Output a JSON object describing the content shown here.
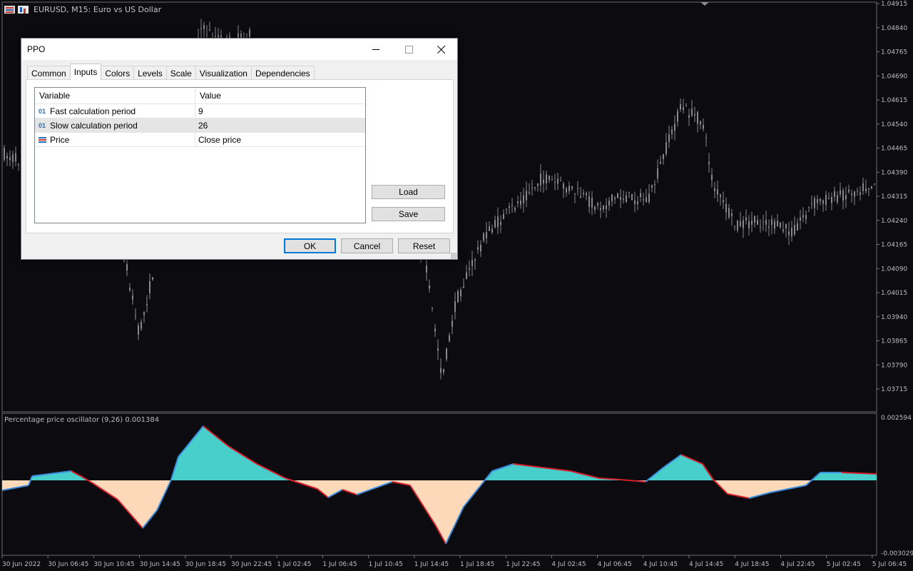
{
  "chart": {
    "title": "EURUSD, M15:  Euro vs US Dollar",
    "indicator_label": "Percentage price oscillator (9,26) 0.001384",
    "price_levels": [
      "1.04915",
      "1.04840",
      "1.04765",
      "1.04690",
      "1.04615",
      "1.04540",
      "1.04465",
      "1.04390",
      "1.04315",
      "1.04240",
      "1.04165",
      "1.04090",
      "1.04015",
      "1.03940",
      "1.03865",
      "1.03790",
      "1.03715"
    ],
    "indicator_levels": [
      "0.002594",
      "-0.003029"
    ],
    "time_labels": [
      "30 Jun 2022",
      "30 Jun 06:45",
      "30 Jun 10:45",
      "30 Jun 14:45",
      "30 Jun 18:45",
      "30 Jun 22:45",
      "1 Jul 02:45",
      "1 Jul 06:45",
      "1 Jul 10:45",
      "1 Jul 14:45",
      "1 Jul 18:45",
      "1 Jul 22:45",
      "4 Jul 02:45",
      "4 Jul 06:45",
      "4 Jul 10:45",
      "4 Jul 14:45",
      "4 Jul 18:45",
      "4 Jul 22:45",
      "5 Jul 02:45",
      "5 Jul 06:45"
    ],
    "colors": {
      "background": "#0b0b10",
      "candle": "#8a8a8a",
      "pos_fill": "#48cfcb",
      "neg_fill": "#fdd9b9",
      "line_up": "#3b8cdc",
      "line_down": "#d5202c"
    }
  },
  "dialog": {
    "title": "PPO",
    "tabs": [
      "Common",
      "Inputs",
      "Colors",
      "Levels",
      "Scale",
      "Visualization",
      "Dependencies"
    ],
    "active_tab": "Inputs",
    "grid": {
      "headers": {
        "variable": "Variable",
        "value": "Value"
      },
      "rows": [
        {
          "type": "01",
          "variable": "Fast calculation period",
          "value": "9"
        },
        {
          "type": "01",
          "variable": "Slow calculation period",
          "value": "26"
        },
        {
          "type": "price-icon",
          "variable": "Price",
          "value": "Close price"
        }
      ]
    },
    "buttons": {
      "load": "Load",
      "save": "Save",
      "ok": "OK",
      "cancel": "Cancel",
      "reset": "Reset"
    }
  }
}
